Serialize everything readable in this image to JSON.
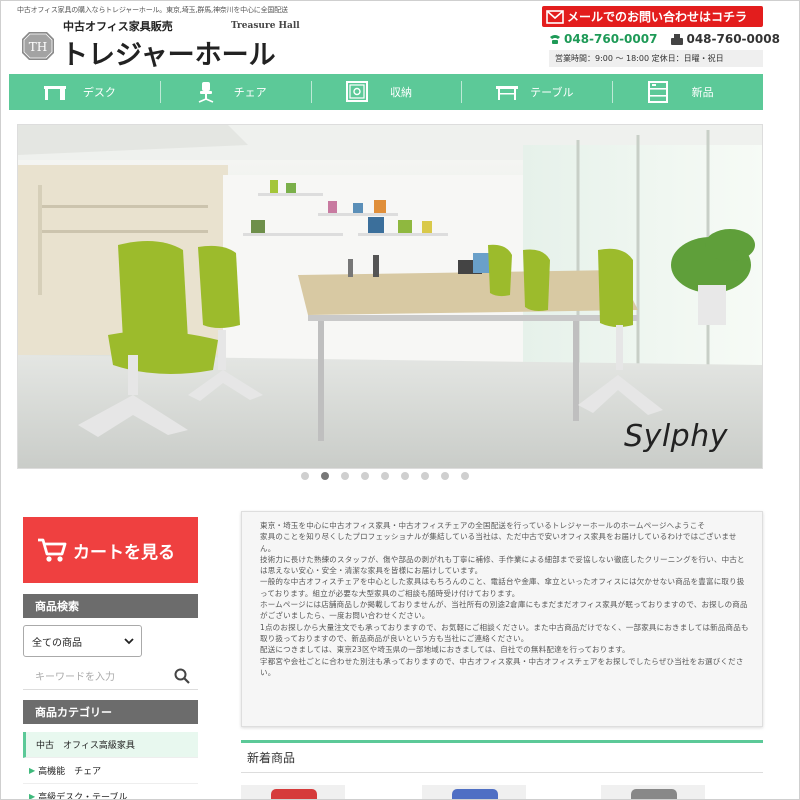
{
  "header": {
    "tagline": "中古オフィス家具の購入ならトレジャーホール。東京,埼玉,群馬,神奈川を中心に全国配送",
    "logo_badge": "TH",
    "logo_sub": "中古オフィス家具販売",
    "logo_en": "Treasure Hall",
    "logo_main": "トレジャーホール",
    "mail_button": "メールでのお問い合わせはコチラ",
    "tel": "048-760-0007",
    "fax": "048-760-0008",
    "hours": "営業時間：9:00 ～ 18:00 定休日：日曜・祝日"
  },
  "nav": [
    {
      "label": "デスク",
      "icon": "desk-icon"
    },
    {
      "label": "チェア",
      "icon": "chair-icon"
    },
    {
      "label": "収納",
      "icon": "safe-icon"
    },
    {
      "label": "テーブル",
      "icon": "table-icon"
    },
    {
      "label": "新品",
      "icon": "cabinet-icon"
    }
  ],
  "slider": {
    "caption": "Sylphy",
    "dots": 9,
    "active_dot": 2
  },
  "sidebar": {
    "cart_button": "カートを見る",
    "search_heading": "商品検索",
    "select_value": "全ての商品",
    "search_placeholder": "キーワードを入力",
    "category_heading": "商品カテゴリー",
    "categories": [
      "中古　オフィス高級家具",
      "高機能　チェア",
      "高級デスク・テーブル"
    ]
  },
  "intro": {
    "paragraphs": [
      "東京・埼玉を中心に中古オフィス家具・中古オフィスチェアの全国配送を行っているトレジャーホールのホームページへようこそ",
      "家具のことを知り尽くしたプロフェッショナルが集結している当社は、ただ中古で安いオフィス家具をお届けしているわけではございません。",
      "技術力に長けた熟練のスタッフが、傷や部品の剥がれも丁寧に補修、手作業による細部まで妥協しない徹底したクリーニングを行い、中古とは思えない安心・安全・清潔な家具を皆様にお届けしています。",
      "一般的な中古オフィスチェアを中心とした家具はもちろんのこと、電話台や金庫、傘立といったオフィスには欠かせない商品を豊富に取り扱っております。組立が必要な大型家具のご相談も随時受け付けております。",
      "ホームページには店舗商品しか掲載しておりませんが、当社所有の別途2倉庫にもまだまだオフィス家具が眠っておりますので、お探しの商品がございましたら、一度お問い合わせください。",
      "1点のお探しから大量注文でも承っておりますので、お気軽にご相談ください。また中古商品だけでなく、一部家具におきましては新品商品も取り扱っておりますので、新品商品が良いという方も当社にご連絡ください。",
      "配送につきましては、東京23区や埼玉県の一部地域におきましては、自社での無料配達を行っております。",
      "宇都宮や会社ごとに合わせた別注も承っておりますので、中古オフィス家具・中古オフィスチェアをお探しでしたらぜひ当社をお選びください。"
    ]
  },
  "new_products_heading": "新着商品",
  "colors": {
    "accent_green": "#5cc998",
    "mail_red": "#e31d1d",
    "cart_red": "#ef4040",
    "tel_green": "#1e9a57",
    "sidebar_gray": "#6c6c6c"
  }
}
